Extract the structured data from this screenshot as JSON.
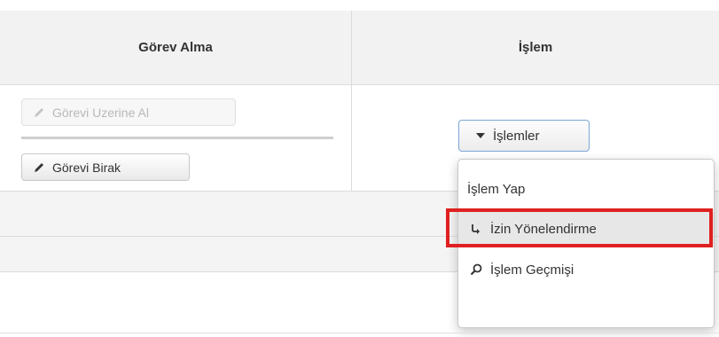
{
  "table": {
    "columns": [
      "Görev Alma",
      "İşlem"
    ]
  },
  "task_actions": {
    "take_task": "Görevi Uzerine Al",
    "release_task": "Görevi Birak"
  },
  "operations": {
    "dropdown_label": "İşlemler",
    "menu_items": [
      "İşlem Yap",
      "İzin Yönelendirme",
      "İşlem Geçmişi"
    ],
    "highlighted_item": "İzin Yönelendirme"
  },
  "icons": {
    "take_task": "pencil-icon",
    "release_task": "pencil-icon",
    "dropdown": "caret-down-icon",
    "redirect": "share-arrow-icon",
    "history": "search-key-icon"
  },
  "colors": {
    "highlight_box": "#e02020",
    "dropdown_border": "#7ba7d8"
  }
}
